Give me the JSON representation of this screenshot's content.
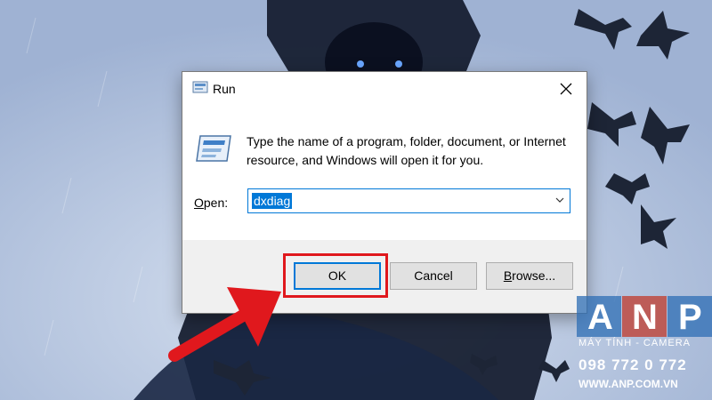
{
  "dialog": {
    "title": "Run",
    "description": "Type the name of a program, folder, document, or Internet resource, and Windows will open it for you.",
    "open_label_prefix": "O",
    "open_label_rest": "pen:",
    "input_value": "dxdiag",
    "buttons": {
      "ok": "OK",
      "cancel": "Cancel",
      "browse_underlined": "B",
      "browse_rest": "rowse..."
    }
  },
  "watermark": {
    "letters": [
      "A",
      "N",
      "P"
    ],
    "subtitle": "MÁY TÍNH - CAMERA",
    "phone": "098 772 0 772",
    "url": "WWW.ANP.COM.VN"
  },
  "colors": {
    "accent": "#0078d7",
    "highlight": "#e0181d",
    "watermark_a": "#2e6db4",
    "watermark_n": "#c0392b",
    "watermark_p": "#2e6db4"
  },
  "icons": {
    "title_icon": "run-icon",
    "close_icon": "close-icon",
    "program_icon": "run-program-icon",
    "dropdown_icon": "chevron-down-icon"
  }
}
